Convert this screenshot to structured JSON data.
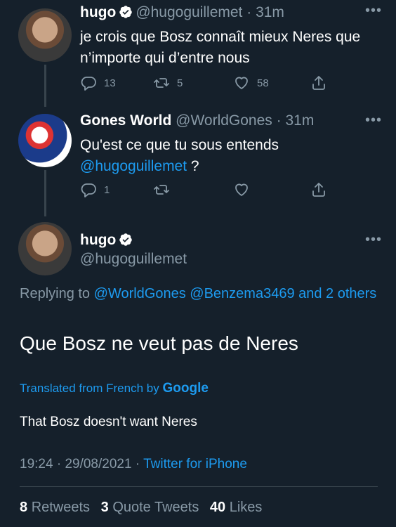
{
  "tweet1": {
    "name": "hugo",
    "handle": "@hugoguillemet",
    "time": "31m",
    "text_line1": "je crois que Bosz connaît mieux Neres que",
    "text_line2": "n’importe qui d’entre nous",
    "replies": "13",
    "retweets": "5",
    "likes": "58"
  },
  "tweet2": {
    "name": "Gones World",
    "handle": "@WorldGones",
    "time": "31m",
    "text_line1": "Qu'est ce que tu sous entends",
    "mention": "@hugoguillemet",
    "text_after_mention": "?",
    "replies": "1"
  },
  "main": {
    "name": "hugo",
    "handle": "@hugoguillemet",
    "replying_label": "Replying to",
    "replying_mentions": "@WorldGones @Benzema3469 and 2 others",
    "text": "Que Bosz ne veut pas de Neres",
    "translated_label": "Translated from French by",
    "google_label": "Google",
    "translation": "That Bosz doesn't want Neres",
    "time": "19:24",
    "date": "29/08/2021",
    "source": "Twitter for iPhone",
    "retweets_count": "8",
    "retweets_label": "Retweets",
    "quotes_count": "3",
    "quotes_label": "Quote Tweets",
    "likes_count": "40",
    "likes_label": "Likes"
  },
  "icons": {
    "verified": "verified-badge-icon",
    "more": "more-icon",
    "reply": "reply-icon",
    "retweet": "retweet-icon",
    "like": "heart-icon",
    "share": "share-icon"
  },
  "colors": {
    "background": "#15202b",
    "accent": "#1d9bf0",
    "muted": "#8899a6",
    "divider": "#38444d"
  }
}
